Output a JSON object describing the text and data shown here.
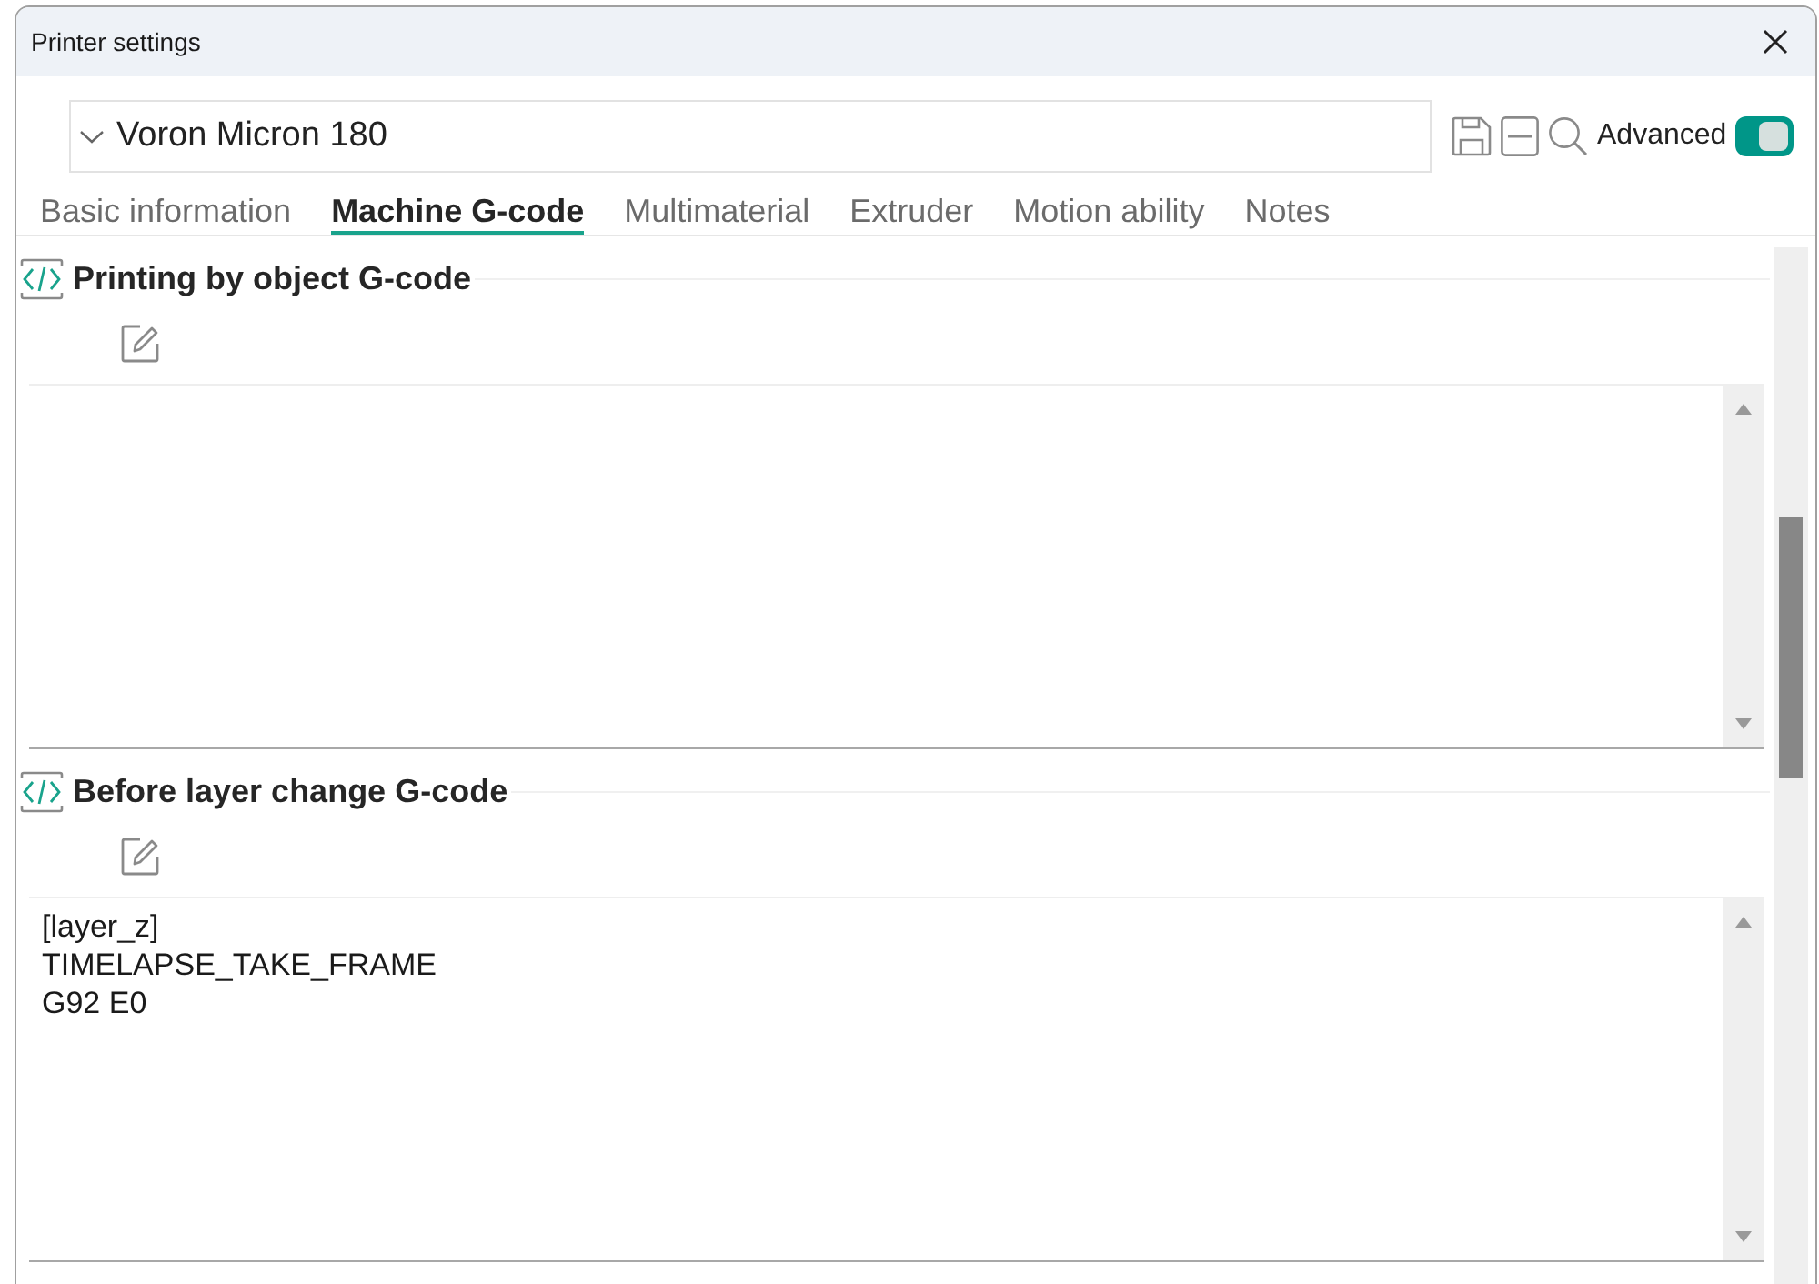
{
  "window": {
    "title": "Printer settings"
  },
  "preset": {
    "value": "Voron Micron 180"
  },
  "advanced": {
    "label": "Advanced",
    "on": true
  },
  "tabs": [
    {
      "label": "Basic information",
      "selected": false
    },
    {
      "label": "Machine G-code",
      "selected": true
    },
    {
      "label": "Multimaterial",
      "selected": false
    },
    {
      "label": "Extruder",
      "selected": false
    },
    {
      "label": "Motion ability",
      "selected": false
    },
    {
      "label": "Notes",
      "selected": false
    }
  ],
  "sections": [
    {
      "title": "Printing by object G-code"
    },
    {
      "title": "Before layer change G-code",
      "value": "[layer_z]\nTIMELAPSE_TAKE_FRAME\nG92 E0"
    }
  ]
}
